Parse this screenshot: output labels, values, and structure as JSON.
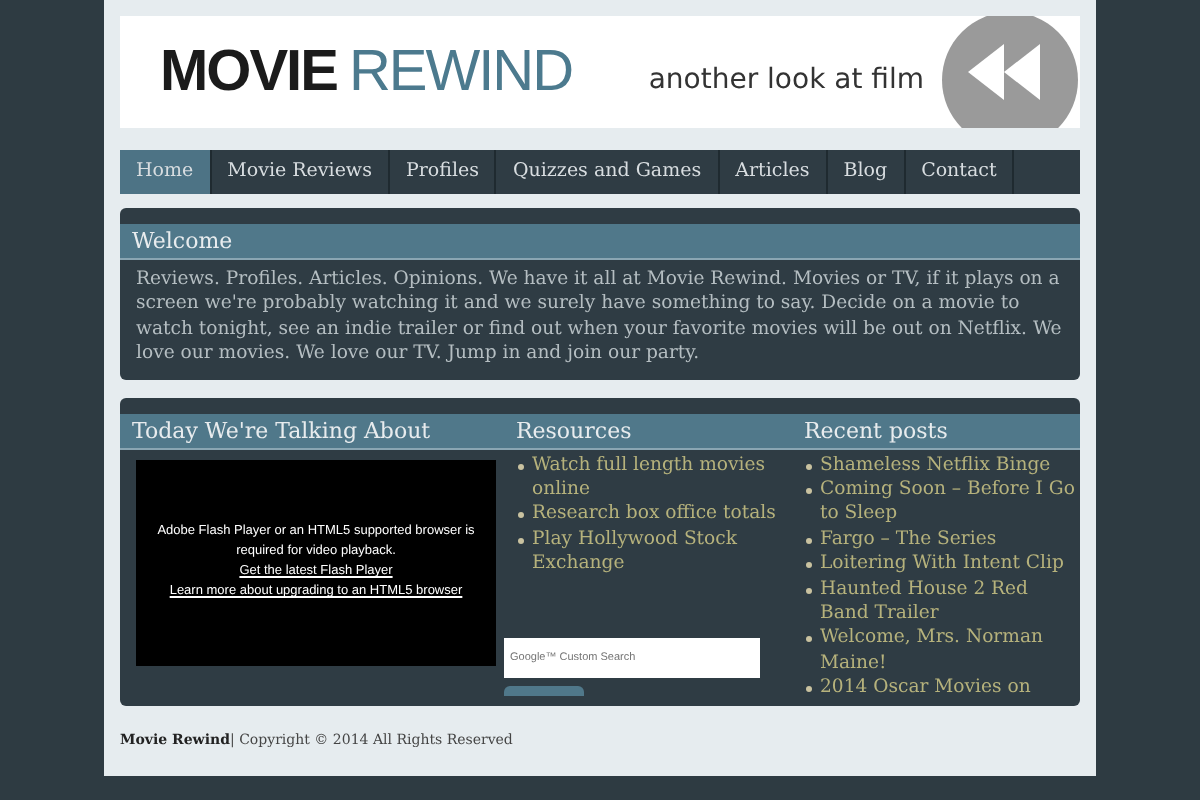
{
  "header": {
    "logo_part1": "MOVIE",
    "logo_part2": "REWIND",
    "tagline": "another look at film"
  },
  "nav": [
    {
      "label": "Home",
      "selected": true
    },
    {
      "label": "Movie Reviews",
      "selected": false
    },
    {
      "label": "Profiles",
      "selected": false
    },
    {
      "label": "Quizzes and Games",
      "selected": false
    },
    {
      "label": "Articles",
      "selected": false
    },
    {
      "label": "Blog",
      "selected": false
    },
    {
      "label": "Contact",
      "selected": false
    }
  ],
  "welcome": {
    "title": "Welcome",
    "text": "Reviews. Profiles. Articles. Opinions. We have it all at Movie Rewind. Movies or TV, if it plays on a screen we're probably watching it and we surely have something to say. Decide on a movie to watch tonight, see an indie trailer or find out when your favorite movies will be out on Netflix. We love our movies. We love our TV. Jump in and join our party."
  },
  "talking": {
    "title": "Today We're Talking About",
    "player_message": "Adobe Flash Player or an HTML5 supported browser is required for video playback.",
    "links": [
      "Get the latest Flash Player",
      "Learn more about upgrading to an HTML5 browser"
    ]
  },
  "resources": {
    "title": "Resources",
    "items": [
      "Watch full length movies online",
      "Research box office totals",
      "Play Hollywood Stock Exchange"
    ],
    "search": {
      "placeholder": "Google™ Custom Search"
    }
  },
  "recent_posts": {
    "title": "Recent posts",
    "items": [
      "Shameless Netflix Binge",
      "Coming Soon – Before I Go to Sleep",
      "Fargo – The Series",
      "Loitering With Intent Clip",
      "Haunted House 2 Red Band Trailer",
      "Welcome, Mrs. Norman Maine!",
      "2014 Oscar Movies on"
    ]
  },
  "footer": {
    "site": "Movie Rewind",
    "text": "| Copyright © 2014 All Rights Reserved"
  }
}
